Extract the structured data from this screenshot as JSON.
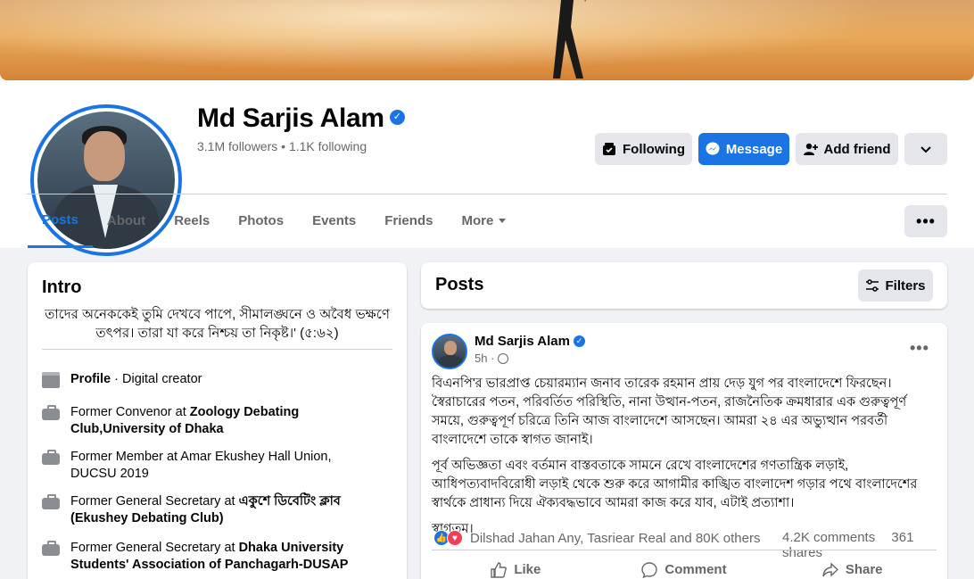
{
  "profile": {
    "name": "Md Sarjis Alam",
    "followers": "3.1M followers",
    "separator": "•",
    "following": "1.1K following",
    "verified_glyph": "✓"
  },
  "actions": {
    "following_label": "Following",
    "message_label": "Message",
    "add_friend_label": "Add friend",
    "more_glyph": "⌄"
  },
  "tabs": [
    {
      "label": "Posts",
      "active": true
    },
    {
      "label": "About"
    },
    {
      "label": "Reels"
    },
    {
      "label": "Photos"
    },
    {
      "label": "Events"
    },
    {
      "label": "Friends"
    },
    {
      "label": "More"
    }
  ],
  "tabs_more_glyph": "•••",
  "intro": {
    "title": "Intro",
    "bio": "তাদের অনেককেই তুমি দেখবে পাপে, সীমালঙ্ঘনে ও অবৈধ ভক্ষণে তৎপর। তারা যা করে নিশ্চয় তা নিকৃষ্ট।' (৫:৬২)",
    "items": [
      {
        "prefix": "Profile",
        "suffix": " · Digital creator",
        "bold_prefix": true
      },
      {
        "prefix": "Former Convenor at ",
        "bold": "Zoology Debating Club,University of Dhaka"
      },
      {
        "prefix": "Former Member at Amar Ekushey Hall Union, DUCSU 2019"
      },
      {
        "prefix": "Former General Secretary at ",
        "bold": "একুশে ডিবেটিং ক্লাব (Ekushey Debating Club)"
      },
      {
        "prefix": "Former General Secretary at ",
        "bold": "Dhaka University Students' Association of Panchagarh-DUSAP"
      }
    ]
  },
  "posts_header": {
    "title": "Posts",
    "filters_label": "Filters"
  },
  "post": {
    "author": "Md Sarjis Alam",
    "time": "5h ·",
    "menu_glyph": "•••",
    "paragraphs": [
      "বিএনপি'র ভারপ্রাপ্ত চেয়ারম্যান জনাব তারেক রহমান প্রায় দেড় যুগ পর বাংলাদেশে ফিরছেন। স্বৈরাচারের পতন, পরিবর্তিত পরিস্থিতি, নানা উত্থান-পতন, রাজনৈতিক ক্রমধারার এক গুরুত্বপূর্ণ সময়ে, গুরুত্বপূর্ণ চরিত্রে তিনি আজ বাংলাদেশে আসছেন। আমরা ২৪ এর অভ্যুত্থান পরবর্তী বাংলাদেশে তাকে স্বাগত জানাই।",
      "পূর্ব অভিজ্ঞতা এবং বর্তমান বাস্তবতাকে সামনে রেখে বাংলাদেশের গণতান্ত্রিক লড়াই, আধিপত্যবাদবিরোধী লড়াই থেকে শুরু করে আগামীর কাঙ্খিত বাংলাদেশ গড়ার পথে বাংলাদেশের স্বার্থকে প্রাধান্য দিয়ে ঐক্যবদ্ধভাবে আমরা কাজ করে যাব, এটাই প্রত্যাশা।",
      "স্বাগতম।"
    ],
    "reactions_text": "Dilshad Jahan Any, Tasriear Real and 80K others",
    "comments": "4.2K comments",
    "shares": "361 shares",
    "like_label": "Like",
    "comment_label": "Comment",
    "share_label": "Share"
  },
  "colors": {
    "accent": "#1b74e4",
    "bg": "#f0f2f5",
    "love": "#f33e58"
  },
  "icons": [
    "verified-badge-icon",
    "following-icon",
    "messenger-icon",
    "add-friend-icon",
    "chevron-down-icon",
    "more-dots-icon",
    "profile-flag-icon",
    "briefcase-icon",
    "filters-icon",
    "globe-icon",
    "like-reaction-icon",
    "love-reaction-icon",
    "thumbs-up-icon",
    "comment-icon",
    "share-icon"
  ]
}
